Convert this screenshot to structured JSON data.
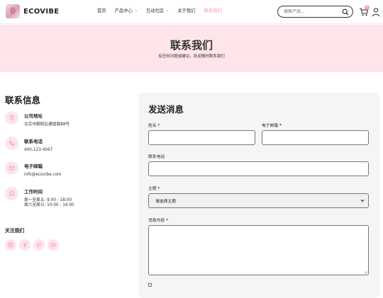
{
  "header": {
    "brand": "ECOVIBE",
    "nav": [
      {
        "label": "首页",
        "has_dropdown": false,
        "active": false
      },
      {
        "label": "产品中心",
        "has_dropdown": true,
        "active": false
      },
      {
        "label": "互动社区",
        "has_dropdown": true,
        "active": false
      },
      {
        "label": "关于我们",
        "has_dropdown": false,
        "active": false
      },
      {
        "label": "联系我们",
        "has_dropdown": false,
        "active": true
      }
    ],
    "search_placeholder": "搜索产品...",
    "cart_count": "0"
  },
  "hero": {
    "title": "联系我们",
    "subtitle": "有任何问题或建议，欢迎随时联系我们"
  },
  "contact_info": {
    "title": "联系信息",
    "items": [
      {
        "icon": "map-pin-icon",
        "label": "公司地址",
        "value": "北京市朝阳区建国路88号"
      },
      {
        "icon": "phone-icon",
        "label": "联系电话",
        "value": "400-123-4567"
      },
      {
        "icon": "mail-icon",
        "label": "电子邮箱",
        "value": "info@ecovibe.com"
      },
      {
        "icon": "clock-icon",
        "label": "工作时间",
        "value": "周一至周五: 9:00 - 18:00",
        "value2": "周六至周日: 10:00 - 16:00"
      }
    ],
    "follow_title": "关注我们",
    "socials": [
      "instagram-icon",
      "facebook-icon",
      "twitter-icon",
      "youtube-icon"
    ]
  },
  "form": {
    "title": "发送消息",
    "name_label": "姓名 *",
    "email_label": "电子邮箱 *",
    "phone_label": "联系电话",
    "subject_label": "主题 *",
    "subject_selected": "请选择主题",
    "message_label": "消息内容 *"
  },
  "colors": {
    "accent": "#f59ab6",
    "hero_bg": "#fde5ea",
    "card_bg": "#f5f5f5"
  }
}
